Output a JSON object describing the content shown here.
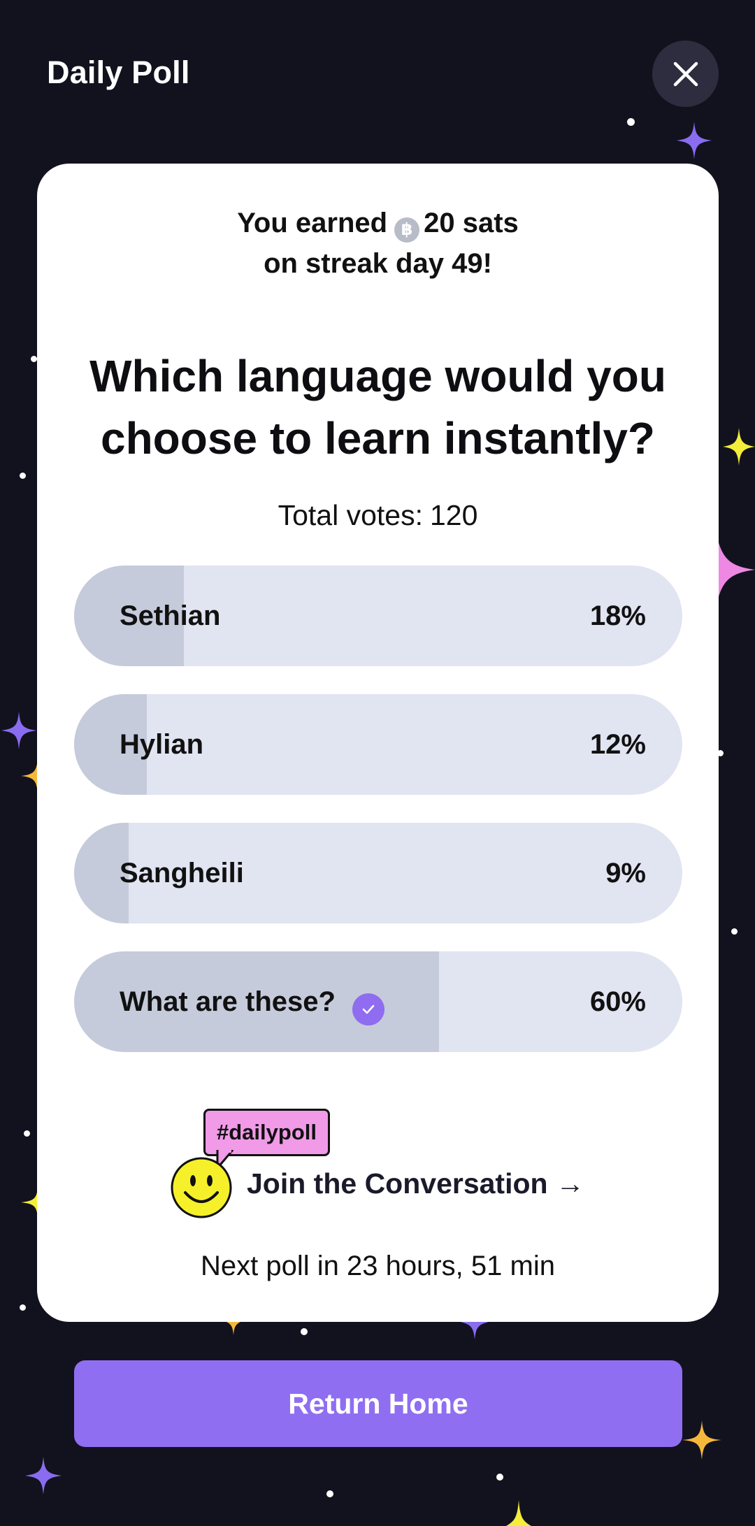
{
  "header": {
    "title": "Daily Poll"
  },
  "reward": {
    "prefix": "You earned",
    "coin_symbol": "฿",
    "amount": "20 sats",
    "line2": "on streak day 49!"
  },
  "poll": {
    "question_line1": "Which language would you",
    "question_line2": "choose to learn instantly?",
    "total_label": "Total votes:",
    "total_value": "120",
    "options": [
      {
        "label": "Sethian",
        "percent": "18%",
        "fill_fraction": 0.18,
        "selected": false
      },
      {
        "label": "Hylian",
        "percent": "12%",
        "fill_fraction": 0.12,
        "selected": false
      },
      {
        "label": "Sangheili",
        "percent": "9%",
        "fill_fraction": 0.09,
        "selected": false
      },
      {
        "label": "What are these?",
        "percent": "60%",
        "fill_fraction": 0.6,
        "selected": true
      }
    ]
  },
  "community": {
    "hashtag": "#dailypoll",
    "join_label": "Join the Conversation →"
  },
  "next_poll": "Next poll in 23 hours, 51 min",
  "footer": {
    "return_label": "Return Home"
  },
  "colors": {
    "background": "#12121f",
    "accent": "#8f6ef2",
    "option_track": "#e1e4f1",
    "option_fill": "#c5cbdb",
    "hashtag_bg": "#f09ae8",
    "smiley": "#f6f02a"
  }
}
